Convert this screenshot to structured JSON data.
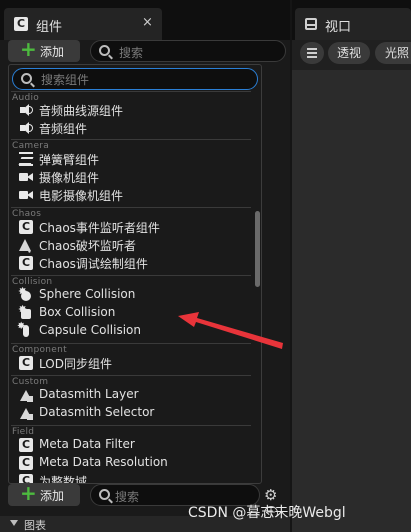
{
  "left_panel": {
    "tab_icon": "component-c-icon",
    "tab_title": "组件",
    "tab_close": "×",
    "add_label": "添加",
    "search_placeholder": "搜索",
    "bottom_add_label": "添加",
    "bottom_search_placeholder": "搜索",
    "graph_label": "图表"
  },
  "viewport": {
    "tab_title": "视口",
    "menu_icon": "hamburger-menu-icon",
    "perspective_label": "透视",
    "lighting_label": "光照"
  },
  "dropdown": {
    "search_placeholder": "搜索组件",
    "categories": [
      {
        "label": "Audio",
        "items": [
          {
            "label": "音频曲线源组件",
            "icon": "speaker-icon"
          },
          {
            "label": "音频组件",
            "icon": "speaker-icon"
          }
        ]
      },
      {
        "label": "Camera",
        "items": [
          {
            "label": "弹簧臂组件",
            "icon": "spring-arm-icon"
          },
          {
            "label": "摄像机组件",
            "icon": "camera-icon"
          },
          {
            "label": "电影摄像机组件",
            "icon": "camera-icon"
          }
        ]
      },
      {
        "label": "Chaos",
        "items": [
          {
            "label": "Chaos事件监听者组件",
            "icon": "component-c-icon"
          },
          {
            "label": "Chaos破坏监听者",
            "icon": "break-listener-icon"
          },
          {
            "label": "Chaos调试绘制组件",
            "icon": "component-c-icon"
          }
        ]
      },
      {
        "label": "Collision",
        "items": [
          {
            "label": "Sphere Collision",
            "icon": "sphere-collision-icon"
          },
          {
            "label": "Box Collision",
            "icon": "box-collision-icon"
          },
          {
            "label": "Capsule Collision",
            "icon": "capsule-collision-icon"
          }
        ]
      },
      {
        "label": "Component",
        "items": [
          {
            "label": "LOD同步组件",
            "icon": "component-c-icon"
          }
        ]
      },
      {
        "label": "Custom",
        "items": [
          {
            "label": "Datasmith Layer",
            "icon": "datasmith-icon"
          },
          {
            "label": "Datasmith Selector",
            "icon": "datasmith-icon"
          }
        ]
      },
      {
        "label": "Field",
        "items": [
          {
            "label": "Meta Data Filter",
            "icon": "component-c-icon"
          },
          {
            "label": "Meta Data Resolution",
            "icon": "component-c-icon"
          },
          {
            "label": "为整数域",
            "icon": "component-c-icon"
          }
        ]
      }
    ]
  },
  "annotation": {
    "color": "#e8343a"
  },
  "watermark": "CSDN @暮志未晚Webgl",
  "colors": {
    "accent_focus": "#2a7fd6",
    "add_plus": "#4dbb3f",
    "panel_bg": "#1a1a1a"
  }
}
